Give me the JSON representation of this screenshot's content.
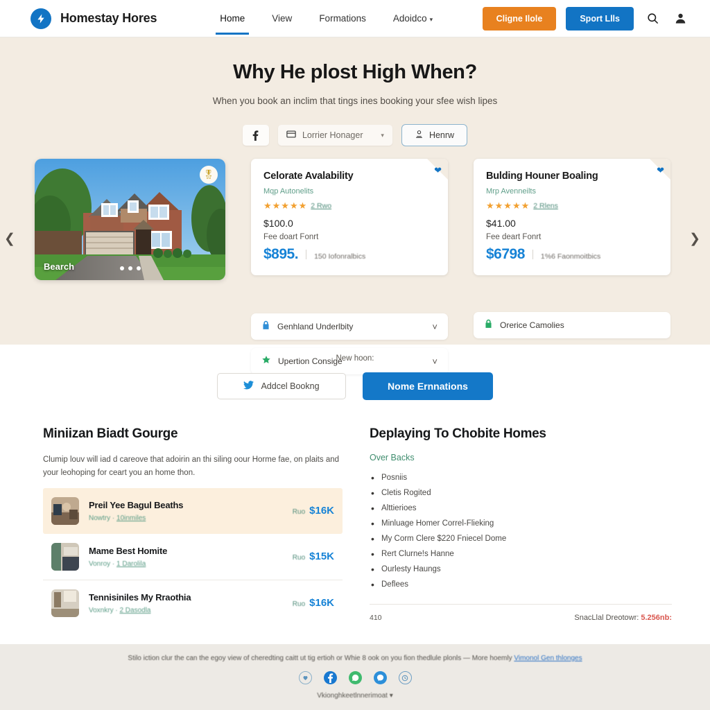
{
  "header": {
    "brand": "Homestay Hores",
    "logo_icon": "lightning-bolt-icon",
    "nav": [
      {
        "label": "Home",
        "active": true
      },
      {
        "label": "View",
        "active": false
      },
      {
        "label": "Formations",
        "active": false
      },
      {
        "label": "Adoidco",
        "active": false,
        "caret": "▾"
      }
    ],
    "cta_orange": "Cligne Ilole",
    "cta_blue": "Sport Llls",
    "search_icon": "search-icon",
    "account_icon": "user-account-icon",
    "accent_orange": "#e8811f",
    "accent_blue": "#1274c4"
  },
  "hero": {
    "title": "Why He plost High When?",
    "subtitle": "When you book an inclim that tings ines booking your sfee wish lipes",
    "filters": {
      "facebook_pill_icon": "facebook-f-icon",
      "select_icon": "card-icon",
      "select_value": "Lorrier Honager",
      "select_caret": "▾",
      "outline_icon": "user-outline-icon",
      "outline_label": "Henrw"
    },
    "background": "#f3ece2"
  },
  "carousel": {
    "prev_icon": "chevron-left-icon",
    "next_icon": "chevron-right-icon",
    "photo_label": "Bearch",
    "photo_badge_icon": "award-badge-icon",
    "dots": 3,
    "photo_alt": "two-story brick suburban house with attached garage and green lawn"
  },
  "cards": [
    {
      "title": "Celorate Avalability",
      "meta": "Mqp  Autonelits",
      "stars": 5,
      "reviews": "2 Rwo",
      "price_small": "$100.0",
      "note": "Fee doart Fonrt",
      "price_big": "$895.",
      "price_note": "150 Iofonralbics",
      "heart_icon": "heart-icon"
    },
    {
      "title": "Bulding Houner Boaling",
      "meta": "Mrp  Avenneilts",
      "stars": 5,
      "reviews": "2 Rlens",
      "price_small": "$41.00",
      "note": "Fee deart Fonrt",
      "price_big": "$6798",
      "price_note": "1%6 Faonmoitbics",
      "heart_icon": "heart-icon"
    }
  ],
  "accordions": [
    {
      "icon": "lock-blue-icon",
      "label": "Genhland Underlbity",
      "caret": "⌄"
    },
    {
      "icon": "star-green-icon",
      "label": "Upertion Consige",
      "caret": "⌄"
    },
    {
      "icon": "lock-green-icon",
      "label": "Orerice Camolies",
      "caret": ""
    }
  ],
  "mid_cta": {
    "label": "New hoon:",
    "outline_icon": "twitter-bird-icon",
    "outline_label": "Addcel Bookng",
    "primary_label": "Nome Ernnations"
  },
  "left_column": {
    "title": "Miniizan Biadt Gourge",
    "paragraph": "Clumip louv will iad d careove that adoirin an thi siling oour Horme fae, on plaits and your leohoping for ceart you an home thon.",
    "listings": [
      {
        "title": "Preil Yee Bagul Beaths",
        "sub_pre": "Nowtry",
        "sub_link": "10inmiles",
        "price_pre": "Ruo",
        "price": "$16K",
        "highlighted": true,
        "thumb_alt": "living room interior"
      },
      {
        "title": "Mame Best Homite",
        "sub_pre": "Vonroy",
        "sub_link": "1 Darolila",
        "price_pre": "Ruo",
        "price": "$15K",
        "highlighted": false,
        "thumb_alt": "bedroom interior"
      },
      {
        "title": "Tennisiniles My Rraothia",
        "sub_pre": "Voxnkry",
        "sub_link": "2 Dasodla",
        "price_pre": "Ruo",
        "price": "$16K",
        "highlighted": false,
        "thumb_alt": "kitchen interior"
      }
    ]
  },
  "right_column": {
    "title": "Deplaying To Chobite Homes",
    "subtitle": "Over Backs",
    "bullets": [
      "Posniis",
      "Cletis Rogited",
      "Alttierioes",
      "Minluage Homer Correl-Flieking",
      "My Corm Clere  $220 Fniecel Dome",
      "Rert Clurne!s Hanne",
      "Ourlesty Haungs",
      "Deflees"
    ],
    "footer_left": "410",
    "footer_right_label": "SnacLlal Dreotowr:",
    "footer_right_value": "5.256nb:"
  },
  "footer": {
    "text": "Stilo iction clur the can the egoy view of cheredting caitt ut tig ertioh or Whie 8 ook on you fion thedlule plonls — More hoemly",
    "link": "Vimonol Gen thlonges",
    "social": [
      {
        "name": "heart-circle-icon",
        "color": "#ffffff",
        "border": "#8ab0c9"
      },
      {
        "name": "facebook-icon",
        "color": "#1878d0",
        "border": "#1878d0"
      },
      {
        "name": "whatsapp-icon",
        "color": "#3fba6e",
        "border": "#3fba6e"
      },
      {
        "name": "messenger-icon",
        "color": "#2c8fd9",
        "border": "#2c8fd9"
      },
      {
        "name": "clock-icon",
        "color": "#ffffff",
        "border": "#6d9ec4"
      }
    ],
    "selector": "Vkionghkeetlnnerimoat",
    "selector_caret": "▾",
    "background": "#edeae5"
  }
}
